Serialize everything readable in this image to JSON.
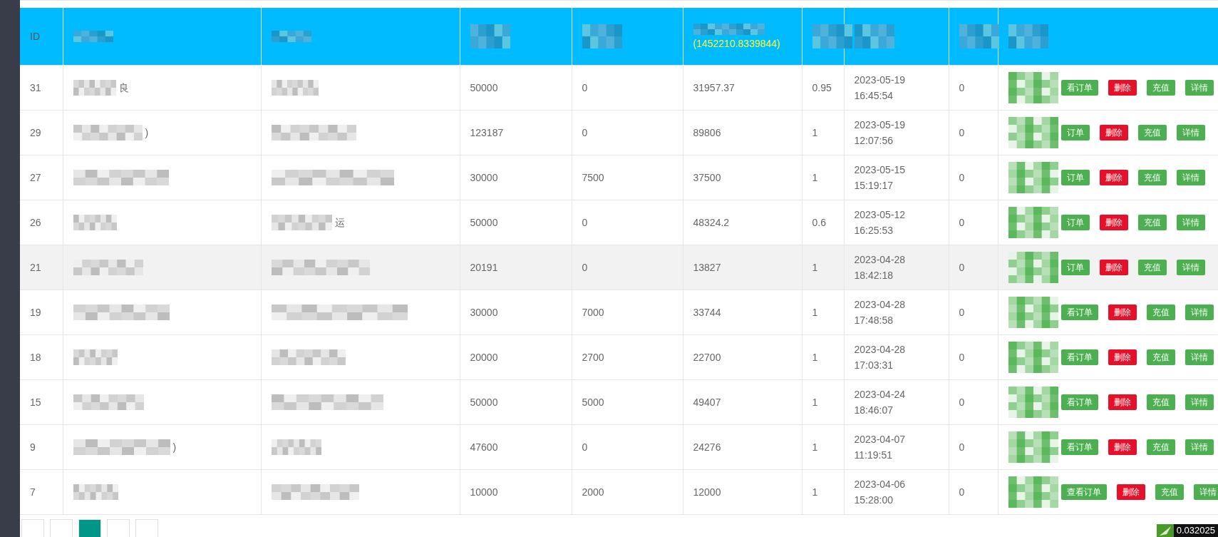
{
  "table": {
    "columns": [
      {
        "kind": "text",
        "label": "ID"
      },
      {
        "kind": "redacted"
      },
      {
        "kind": "redacted"
      },
      {
        "kind": "redacted"
      },
      {
        "kind": "redacted"
      },
      {
        "kind": "redacted",
        "note": "(1452210.8339844)"
      },
      {
        "kind": "redacted"
      },
      {
        "kind": "redacted"
      },
      {
        "kind": "redacted"
      },
      {
        "kind": "redacted"
      }
    ],
    "rows": [
      {
        "id": "31",
        "name_tail": "良",
        "contact_tail": "",
        "amount": "50000",
        "bonus": "0",
        "balance": "31957.37",
        "rate": "0.95",
        "date": "2023-05-19",
        "time": "16:45:54",
        "count": "0",
        "highlighted": false,
        "actions": [
          {
            "kind": "partial",
            "label": "看订单"
          },
          {
            "kind": "danger",
            "label": "删除"
          },
          {
            "kind": "normal",
            "label": "充值"
          },
          {
            "kind": "normal",
            "label": "详情"
          }
        ]
      },
      {
        "id": "29",
        "name_tail": ")",
        "contact_tail": "",
        "amount": "123187",
        "bonus": "0",
        "balance": "89806",
        "rate": "1",
        "date": "2023-05-19",
        "time": "12:07:56",
        "count": "0",
        "highlighted": false,
        "actions": [
          {
            "kind": "partial",
            "label": "订单"
          },
          {
            "kind": "danger",
            "label": "删除"
          },
          {
            "kind": "normal",
            "label": "充值"
          },
          {
            "kind": "normal",
            "label": "详情"
          }
        ]
      },
      {
        "id": "27",
        "name_tail": "",
        "contact_tail": "",
        "amount": "30000",
        "bonus": "7500",
        "balance": "37500",
        "rate": "1",
        "date": "2023-05-15",
        "time": "15:19:17",
        "count": "0",
        "highlighted": false,
        "actions": [
          {
            "kind": "partial",
            "label": "订单"
          },
          {
            "kind": "danger",
            "label": "删除"
          },
          {
            "kind": "normal",
            "label": "充值"
          },
          {
            "kind": "normal",
            "label": "详情"
          }
        ]
      },
      {
        "id": "26",
        "name_tail": "",
        "contact_tail": "运",
        "amount": "50000",
        "bonus": "0",
        "balance": "48324.2",
        "rate": "0.6",
        "date": "2023-05-12",
        "time": "16:25:53",
        "count": "0",
        "highlighted": false,
        "actions": [
          {
            "kind": "partial",
            "label": "订单"
          },
          {
            "kind": "danger",
            "label": "删除"
          },
          {
            "kind": "normal",
            "label": "充值"
          },
          {
            "kind": "normal",
            "label": "详情"
          }
        ]
      },
      {
        "id": "21",
        "name_tail": "",
        "contact_tail": "",
        "amount": "20191",
        "bonus": "0",
        "balance": "13827",
        "rate": "1",
        "date": "2023-04-28",
        "time": "18:42:18",
        "count": "0",
        "highlighted": true,
        "actions": [
          {
            "kind": "partial",
            "label": "订单"
          },
          {
            "kind": "danger",
            "label": "删除"
          },
          {
            "kind": "normal",
            "label": "充值"
          },
          {
            "kind": "normal",
            "label": "详情"
          }
        ]
      },
      {
        "id": "19",
        "name_tail": "",
        "contact_tail": "",
        "amount": "30000",
        "bonus": "7000",
        "balance": "33744",
        "rate": "1",
        "date": "2023-04-28",
        "time": "17:48:58",
        "count": "0",
        "highlighted": false,
        "actions": [
          {
            "kind": "partial",
            "label": "看订单"
          },
          {
            "kind": "danger",
            "label": "删除"
          },
          {
            "kind": "normal",
            "label": "充值"
          },
          {
            "kind": "normal",
            "label": "详情"
          }
        ]
      },
      {
        "id": "18",
        "name_tail": "",
        "contact_tail": "",
        "amount": "20000",
        "bonus": "2700",
        "balance": "22700",
        "rate": "1",
        "date": "2023-04-28",
        "time": "17:03:31",
        "count": "0",
        "highlighted": false,
        "actions": [
          {
            "kind": "partial",
            "label": "看订单"
          },
          {
            "kind": "danger",
            "label": "删除"
          },
          {
            "kind": "normal",
            "label": "充值"
          },
          {
            "kind": "normal",
            "label": "详情"
          }
        ]
      },
      {
        "id": "15",
        "name_tail": "",
        "contact_tail": "",
        "amount": "50000",
        "bonus": "5000",
        "balance": "49407",
        "rate": "1",
        "date": "2023-04-24",
        "time": "18:46:07",
        "count": "0",
        "highlighted": false,
        "actions": [
          {
            "kind": "partial",
            "label": "看订单"
          },
          {
            "kind": "danger",
            "label": "删除"
          },
          {
            "kind": "normal",
            "label": "充值"
          },
          {
            "kind": "normal",
            "label": "详情"
          }
        ]
      },
      {
        "id": "9",
        "name_tail": ")",
        "contact_tail": "",
        "amount": "47600",
        "bonus": "0",
        "balance": "24276",
        "rate": "1",
        "date": "2023-04-07",
        "time": "11:19:51",
        "count": "0",
        "highlighted": false,
        "actions": [
          {
            "kind": "partial",
            "label": "看订单"
          },
          {
            "kind": "danger",
            "label": "删除"
          },
          {
            "kind": "normal",
            "label": "充值"
          },
          {
            "kind": "normal",
            "label": "详情"
          }
        ]
      },
      {
        "id": "7",
        "name_tail": "",
        "contact_tail": "",
        "amount": "10000",
        "bonus": "2000",
        "balance": "12000",
        "rate": "1",
        "date": "2023-04-06",
        "time": "15:28:00",
        "count": "0",
        "highlighted": false,
        "actions": [
          {
            "kind": "partial",
            "label": "查看订单"
          },
          {
            "kind": "danger",
            "label": "删除"
          },
          {
            "kind": "normal",
            "label": "充值"
          },
          {
            "kind": "normal",
            "label": "详情"
          }
        ]
      }
    ]
  },
  "pagination": [
    {
      "selected": false
    },
    {
      "selected": false
    },
    {
      "selected": true
    },
    {
      "selected": false
    },
    {
      "selected": false
    }
  ],
  "overlay_reading": "0.032025"
}
